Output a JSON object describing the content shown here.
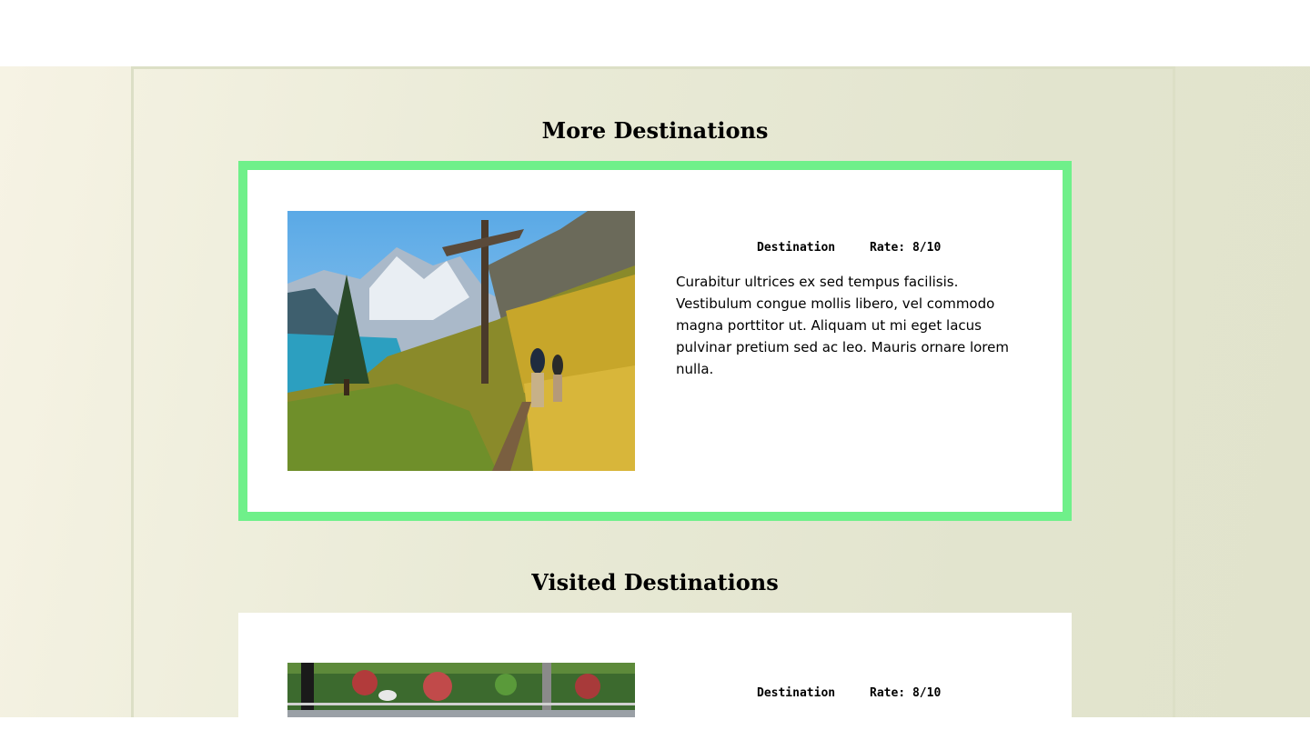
{
  "sections": {
    "more": {
      "title": "More Destinations",
      "card": {
        "image_alt": "hikers on a mountain trail beside a lake",
        "destination_label": "Destination",
        "rate_label": "Rate: 8/10",
        "description": "Curabitur ultrices ex sed tempus facilisis. Vestibulum congue mollis libero, vel commodo magna porttitor ut. Aliquam ut mi eget lacus pulvinar pretium sed ac leo. Mauris ornare lorem nulla."
      }
    },
    "visited": {
      "title": "Visited Destinations",
      "card": {
        "image_alt": "garden with trees and fence",
        "destination_label": "Destination",
        "rate_label": "Rate: 8/10"
      }
    }
  },
  "colors": {
    "highlight_border": "#6ff08a",
    "background_light": "#f6f3e4",
    "background_dark": "#e1e3cc"
  }
}
